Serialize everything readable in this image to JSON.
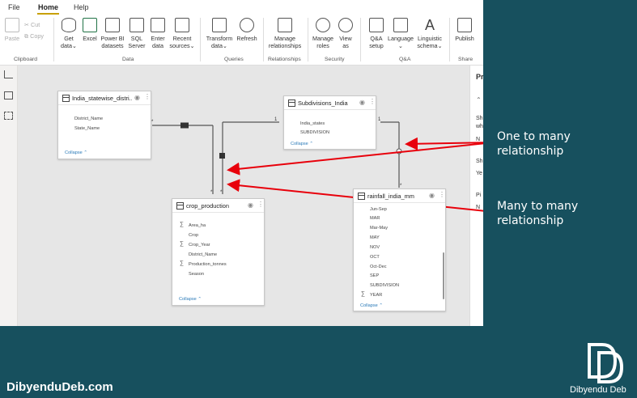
{
  "menu": {
    "tabs": [
      {
        "label": "File"
      },
      {
        "label": "Home"
      },
      {
        "label": "Help"
      }
    ]
  },
  "ribbon": {
    "clipboard": {
      "paste": "Paste",
      "cut": "Cut",
      "copy": "Copy",
      "group": "Clipboard"
    },
    "data": {
      "get_data_1": "Get",
      "get_data_2": "data",
      "excel": "Excel",
      "powerbi_1": "Power BI",
      "powerbi_2": "datasets",
      "sql_1": "SQL",
      "sql_2": "Server",
      "enter_1": "Enter",
      "enter_2": "data",
      "recent_1": "Recent",
      "recent_2": "sources",
      "group": "Data"
    },
    "queries": {
      "transform_1": "Transform",
      "transform_2": "data",
      "refresh": "Refresh",
      "group": "Queries"
    },
    "relationships": {
      "manage_1": "Manage",
      "manage_2": "relationships",
      "group": "Relationships"
    },
    "security": {
      "roles_1": "Manage",
      "roles_2": "roles",
      "view_1": "View",
      "view_2": "as",
      "group": "Security"
    },
    "qa": {
      "setup_1": "Q&A",
      "setup_2": "setup",
      "language": "Language",
      "linguistic_1": "Linguistic",
      "linguistic_2": "schema",
      "group": "Q&A"
    },
    "share": {
      "publish": "Publish",
      "group": "Share"
    }
  },
  "right_pane": {
    "title": "Pr",
    "items": [
      "Sh",
      "wh",
      "N",
      "Sh",
      "Ye",
      "Pi",
      "N"
    ]
  },
  "tables": [
    {
      "title": "India_statewise_distri...",
      "fields": [
        "District_Name",
        "State_Name"
      ],
      "collapse": "Collapse"
    },
    {
      "title": "Subdivisions_India",
      "fields": [
        "India_states",
        "SUBDIVISION"
      ],
      "collapse": "Collapse"
    },
    {
      "title": "crop_production",
      "fields": [
        {
          "name": "Area_ha",
          "sum": true
        },
        {
          "name": "Crop",
          "sum": false
        },
        {
          "name": "Crop_Year",
          "sum": true
        },
        {
          "name": "District_Name",
          "sum": false
        },
        {
          "name": "Production_tonnes",
          "sum": true
        },
        {
          "name": "Season",
          "sum": false
        }
      ],
      "collapse": "Collapse"
    },
    {
      "title": "rainfall_india_mm",
      "fields": [
        {
          "name": "Jun-Sep",
          "sum": false
        },
        {
          "name": "MAR",
          "sum": false
        },
        {
          "name": "Mar-May",
          "sum": false
        },
        {
          "name": "MAY",
          "sum": false
        },
        {
          "name": "NOV",
          "sum": false
        },
        {
          "name": "OCT",
          "sum": false
        },
        {
          "name": "Oct-Dec",
          "sum": false
        },
        {
          "name": "SEP",
          "sum": false
        },
        {
          "name": "SUBDIVISION",
          "sum": false
        },
        {
          "name": "YEAR",
          "sum": true
        }
      ],
      "collapse": "Collapse"
    }
  ],
  "cardinality": {
    "one": "1",
    "many": "*"
  },
  "annotations": {
    "one_to_many_1": "One to many",
    "one_to_many_2": "relationship",
    "many_to_many_1": "Many to many",
    "many_to_many_2": "relationship"
  },
  "footer": {
    "site": "DibyenduDeb.com",
    "author": "Dibyendu Deb"
  },
  "colors": {
    "background": "#17505e",
    "arrow": "#e8000b",
    "collapse_link": "#2a7ab8",
    "accent": "#c8a000"
  }
}
